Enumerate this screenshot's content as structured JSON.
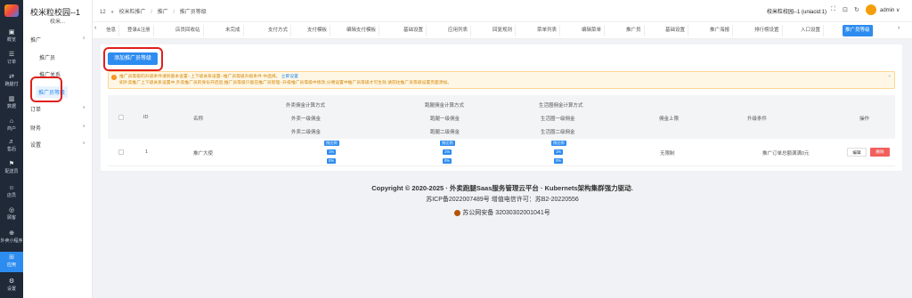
{
  "rail": {
    "items": [
      {
        "glyph": "▣",
        "label": "概览"
      },
      {
        "glyph": "☰",
        "label": "订单"
      },
      {
        "glyph": "⇄",
        "label": "跑腿付"
      },
      {
        "glyph": "▥",
        "label": "数据"
      },
      {
        "glyph": "⌂",
        "label": "商户"
      },
      {
        "glyph": "♬",
        "label": "售后"
      },
      {
        "glyph": "⚑",
        "label": "配送员"
      },
      {
        "glyph": "☺",
        "label": "店员"
      },
      {
        "glyph": "◎",
        "label": "顾客"
      },
      {
        "glyph": "⊕",
        "label": "外卖小程序"
      },
      {
        "glyph": "⊞",
        "label": "应用"
      },
      {
        "glyph": "⚙",
        "label": "设置"
      }
    ]
  },
  "sidebar": {
    "title": "校米粒校园--1",
    "subtitle": "校米...",
    "group_promote": "推广",
    "item_promoter": "推广员",
    "item_relation": "推广关系",
    "item_level": "推广员等级",
    "group_order": "订单",
    "group_finance": "财务",
    "group_settings": "设置"
  },
  "topbar": {
    "count": "12",
    "crumb1": "校米粒推广",
    "crumb2": "推广",
    "crumb3": "推广员等级",
    "uniacid": "校米粒校园--1 (uniacid:1)",
    "username": "admin"
  },
  "tabs": [
    "信息",
    "登录&注册",
    "店员回收站",
    "未完成",
    "支付方式",
    "支付模板",
    "编辑支付模板",
    "基础设置",
    "应用列表",
    "回复规则",
    "菜单列表",
    "编辑菜单",
    "推广员",
    "基础设置",
    "推广海报",
    "排行榜设置",
    "入口设置",
    "推广员等级"
  ],
  "page": {
    "add_button": "添加推广员等级",
    "alert_line1": "推广员等级的升级条件请到基本设置--上下级关系设置--推广员等级升级条件 中选择。",
    "alert_link": "立即设置",
    "alert_line2": "如外卖推广上下级关系设置中,外卖推广员的身份开启后,推广员等级只能在推广员管理--升级推广员等级中修改,分佣设置中推广员等级才可生效,请前往推广员等级设置页面添加。"
  },
  "table": {
    "headers": {
      "id": "ID",
      "name": "名称",
      "waimai_mode": "外卖佣金计算方式",
      "waimai_l1": "外卖一级佣金",
      "waimai_l2": "外卖二级佣金",
      "paotui_mode": "跑腿佣金计算方式",
      "paotui_l1": "跑腿一级佣金",
      "paotui_l2": "跑腿二级佣金",
      "shq_mode": "生活圈佣金计算方式",
      "shq_l1": "生活圈一级佣金",
      "shq_l2": "生活圈二级佣金",
      "limit": "佣金上限",
      "condition": "升级条件",
      "action": "操作"
    },
    "rows": [
      {
        "id": "1",
        "name": "推广大使",
        "waimai": {
          "mode": "按比例",
          "l1": "1%",
          "l2": "0%"
        },
        "paotui": {
          "mode": "按比例",
          "l1": "1%",
          "l2": "0%"
        },
        "shq": {
          "mode": "按比例",
          "l1": "1%",
          "l2": "0%"
        },
        "limit": "无限制",
        "condition": "推广订单总额满满0元",
        "edit": "编辑",
        "delete": "删除"
      }
    ]
  },
  "footer": {
    "copyright": "Copyright © 2020-2025 · 外卖跑腿Saas服务管理云平台 · Kubernets架构集群强力驱动.",
    "icp": "苏ICP备2022007489号     增值电信许可：苏B2-20220556",
    "gongan": "苏公网安备 32030302001041号"
  },
  "colors": {
    "primary": "#2d8cf0",
    "danger": "#f25f5c",
    "highlight": "#e0201c",
    "rail": "#1f2937"
  }
}
